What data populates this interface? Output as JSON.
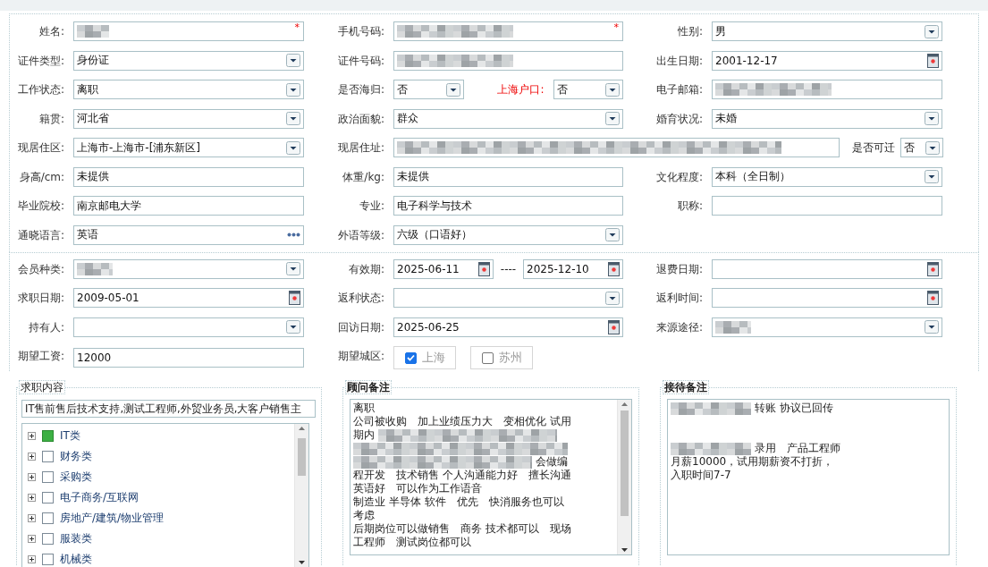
{
  "section_1": {
    "rows": [
      [
        {
          "label": "姓名:",
          "controls": [
            {
              "kind": "text",
              "redacted": true,
              "marker": "*"
            }
          ]
        },
        {
          "label": "手机号码:",
          "controls": [
            {
              "kind": "text",
              "redacted": true,
              "marker": "*"
            }
          ]
        },
        {
          "label": "性别:",
          "controls": [
            {
              "kind": "select",
              "value": "男"
            }
          ]
        }
      ],
      [
        {
          "label": "证件类型:",
          "controls": [
            {
              "kind": "select",
              "value": "身份证"
            }
          ]
        },
        {
          "label": "证件号码:",
          "controls": [
            {
              "kind": "text",
              "redacted": true
            }
          ]
        },
        {
          "label": "出生日期:",
          "controls": [
            {
              "kind": "date",
              "value": "2001-12-17"
            }
          ]
        }
      ],
      [
        {
          "label": "工作状态:",
          "controls": [
            {
              "kind": "select",
              "value": "离职"
            }
          ]
        },
        {
          "label": "是否海归:",
          "controls": [
            {
              "kind": "select",
              "value": "否"
            },
            {
              "kind": "label",
              "text": "上海户口:",
              "alert": true
            },
            {
              "kind": "select",
              "value": "否"
            }
          ]
        },
        {
          "label": "电子邮箱:",
          "controls": [
            {
              "kind": "text",
              "redacted": true
            }
          ]
        }
      ],
      [
        {
          "label": "籍贯:",
          "controls": [
            {
              "kind": "select",
              "value": "河北省"
            }
          ]
        },
        {
          "label": "政治面貌:",
          "controls": [
            {
              "kind": "select",
              "value": "群众"
            }
          ]
        },
        {
          "label": "婚育状况:",
          "controls": [
            {
              "kind": "select",
              "value": "未婚"
            }
          ]
        }
      ],
      [
        {
          "label": "现居住区:",
          "controls": [
            {
              "kind": "select",
              "value": " 上海市-上海市-[浦东新区]"
            }
          ]
        },
        {
          "label": "现居住址:",
          "wide": true,
          "controls": [
            {
              "kind": "text",
              "redacted": true
            },
            {
              "kind": "label",
              "text": "是否可迁",
              "alert": false
            },
            {
              "kind": "select",
              "value": "否"
            }
          ]
        }
      ],
      [
        {
          "label": "身高/cm:",
          "controls": [
            {
              "kind": "text",
              "value": "未提供"
            }
          ]
        },
        {
          "label": "体重/kg:",
          "controls": [
            {
              "kind": "text",
              "value": "未提供"
            }
          ]
        },
        {
          "label": "文化程度:",
          "controls": [
            {
              "kind": "select",
              "value": "本科（全日制）"
            }
          ]
        }
      ],
      [
        {
          "label": "毕业院校:",
          "controls": [
            {
              "kind": "text",
              "value": "南京邮电大学"
            }
          ]
        },
        {
          "label": "专业:",
          "controls": [
            {
              "kind": "text",
              "value": "电子科学与技术"
            }
          ]
        },
        {
          "label": "职称:",
          "controls": [
            {
              "kind": "text"
            }
          ]
        }
      ],
      [
        {
          "label": "通晓语言:",
          "controls": [
            {
              "kind": "more",
              "value": "英语"
            }
          ]
        },
        {
          "label": "外语等级:",
          "controls": [
            {
              "kind": "select",
              "value": "六级（口语好）"
            }
          ]
        }
      ]
    ]
  },
  "section_2": {
    "rows": [
      [
        {
          "label": "会员种类:",
          "controls": [
            {
              "kind": "select",
              "redacted": true
            }
          ]
        },
        {
          "label": "有效期:",
          "controls": [
            {
              "kind": "date",
              "value": "2025-06-11"
            },
            {
              "kind": "sep",
              "text": "----"
            },
            {
              "kind": "date",
              "value": "2025-12-10"
            }
          ]
        },
        {
          "label": "退费日期:",
          "controls": [
            {
              "kind": "date"
            }
          ]
        }
      ],
      [
        {
          "label": "求职日期:",
          "controls": [
            {
              "kind": "date",
              "value": "2009-05-01"
            }
          ]
        },
        {
          "label": "返利状态:",
          "controls": [
            {
              "kind": "select"
            }
          ]
        },
        {
          "label": "返利时间:",
          "controls": [
            {
              "kind": "date"
            }
          ]
        }
      ],
      [
        {
          "label": "持有人:",
          "controls": [
            {
              "kind": "select"
            }
          ]
        },
        {
          "label": "回访日期:",
          "controls": [
            {
              "kind": "date",
              "value": "2025-06-25"
            }
          ]
        },
        {
          "label": "来源途径:",
          "controls": [
            {
              "kind": "select",
              "redacted": true
            }
          ]
        }
      ],
      [
        {
          "label": "期望工资:",
          "controls": [
            {
              "kind": "text",
              "value": "12000"
            }
          ]
        },
        {
          "label": "期望城区:",
          "controls": [
            {
              "kind": "check",
              "text": "上海",
              "checked": true
            },
            {
              "kind": "check",
              "text": "苏州",
              "checked": false
            }
          ]
        }
      ]
    ]
  },
  "job_panel": {
    "title": "求职内容",
    "summary": "IT售前售后技术支持,测试工程师,外贸业务员,大客户销售主",
    "tree": [
      {
        "label": "IT类",
        "partial": true
      },
      {
        "label": "财务类",
        "partial": false
      },
      {
        "label": "采购类",
        "partial": false
      },
      {
        "label": "电子商务/互联网",
        "partial": false
      },
      {
        "label": "房地产/建筑/物业管理",
        "partial": false
      },
      {
        "label": "服装类",
        "partial": false
      },
      {
        "label": "机械类",
        "partial": false
      }
    ]
  },
  "notes": [
    {
      "title": "顾问备注",
      "scrollbar": true,
      "lines": [
        {
          "kind": "text",
          "text": "离职"
        },
        {
          "kind": "text",
          "text": "公司被收购　加上业绩压力大　变相优化 试用"
        },
        {
          "kind": "text",
          "parts": [
            {
              "kind": "text",
              "text": "期内"
            },
            {
              "kind": "redacted"
            }
          ]
        },
        {
          "kind": "text",
          "parts": [
            {
              "kind": "redacted"
            }
          ]
        },
        {
          "kind": "text",
          "parts": [
            {
              "kind": "redacted"
            },
            {
              "kind": "text",
              "text": "会做编"
            }
          ]
        },
        {
          "kind": "text",
          "text": "程开发　技术销售 个人沟通能力好　擅长沟通"
        },
        {
          "kind": "text",
          "text": "英语好　可以作为工作语音"
        },
        {
          "kind": "text",
          "text": "制造业 半导体 软件　优先　快消服务也可以"
        },
        {
          "kind": "text",
          "text": "考虑"
        },
        {
          "kind": "text",
          "text": "后期岗位可以做销售　商务 技术都可以　现场"
        },
        {
          "kind": "text",
          "text": "工程师　测试岗位都可以"
        }
      ]
    },
    {
      "title": "接待备注",
      "scrollbar": false,
      "lines": [
        {
          "kind": "text",
          "parts": [
            {
              "kind": "redacted"
            },
            {
              "kind": "text",
              "text": "转账 协议已回传"
            }
          ]
        },
        {
          "kind": "blank"
        },
        {
          "kind": "blank"
        },
        {
          "kind": "text",
          "parts": [
            {
              "kind": "redacted"
            },
            {
              "kind": "text",
              "text": "录用　产品工程师"
            }
          ]
        },
        {
          "kind": "text",
          "text": "月薪10000，试用期薪资不打折，"
        },
        {
          "kind": "text",
          "text": "入职时间7-7"
        }
      ]
    }
  ]
}
